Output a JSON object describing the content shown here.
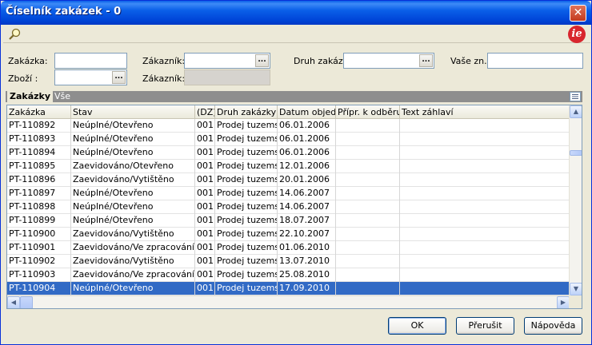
{
  "window": {
    "title": "Číselník zakázek - 0",
    "close_glyph": "✕"
  },
  "toolbar": {
    "search_icon": "search-icon",
    "logo_icon": "ie-logo-icon",
    "logo_text": "ie"
  },
  "filters": {
    "zakazka_label": "Zakázka:",
    "zakazka_value": "",
    "zakaznik_label": "Zákazník:",
    "zakaznik_value": "",
    "druh_label": "Druh zakáz.:",
    "druh_value": "",
    "vase_label": "Vaše zn.:",
    "vase_value": "",
    "zbozi_label": "Zboží  :",
    "zbozi_value": "",
    "zakaznik2_label": "Zákazník:",
    "zakaznik2_value": "",
    "dots": "..."
  },
  "section": {
    "title": "Zakázky",
    "filter": "Vše"
  },
  "grid": {
    "columns": [
      "Zakázka",
      "Stav",
      "(DZ)",
      "Druh zakázky",
      "Datum objedn.",
      "Přípr. k odběru",
      "Text záhlaví"
    ],
    "rows": [
      [
        "PT-110892",
        "Neúplné/Otevřeno",
        "001",
        "Prodej tuzemsko",
        "06.01.2006",
        "",
        ""
      ],
      [
        "PT-110893",
        "Neúplné/Otevřeno",
        "001",
        "Prodej tuzemsko",
        "06.01.2006",
        "",
        ""
      ],
      [
        "PT-110894",
        "Neúplné/Otevřeno",
        "001",
        "Prodej tuzemsko",
        "06.01.2006",
        "",
        ""
      ],
      [
        "PT-110895",
        "Zaevidováno/Otevřeno",
        "001",
        "Prodej tuzemsko",
        "12.01.2006",
        "",
        ""
      ],
      [
        "PT-110896",
        "Zaevidováno/Vytištěno",
        "001",
        "Prodej tuzemsko",
        "20.01.2006",
        "",
        ""
      ],
      [
        "PT-110897",
        "Neúplné/Otevřeno",
        "001",
        "Prodej tuzemsko",
        "14.06.2007",
        "",
        ""
      ],
      [
        "PT-110898",
        "Neúplné/Otevřeno",
        "001",
        "Prodej tuzemsko",
        "14.06.2007",
        "",
        ""
      ],
      [
        "PT-110899",
        "Neúplné/Otevřeno",
        "001",
        "Prodej tuzemsko",
        "18.07.2007",
        "",
        ""
      ],
      [
        "PT-110900",
        "Zaevidováno/Vytištěno",
        "001",
        "Prodej tuzemsko",
        "22.10.2007",
        "",
        ""
      ],
      [
        "PT-110901",
        "Zaevidováno/Ve zpracování",
        "001",
        "Prodej tuzemsko",
        "01.06.2010",
        "",
        ""
      ],
      [
        "PT-110902",
        "Zaevidováno/Vytištěno",
        "001",
        "Prodej tuzemsko",
        "13.07.2010",
        "",
        ""
      ],
      [
        "PT-110903",
        "Zaevidováno/Ve zpracování",
        "001",
        "Prodej tuzemsko",
        "25.08.2010",
        "",
        ""
      ],
      [
        "PT-110904",
        "Neúplné/Otevřeno",
        "001",
        "Prodej tuzemsko",
        "17.09.2010",
        "",
        ""
      ]
    ],
    "selected_row": 12,
    "scroll": {
      "up": "▲",
      "down": "▼",
      "left": "◀",
      "right": "▶"
    }
  },
  "buttons": {
    "ok": "OK",
    "prerusit": "Přerušit",
    "napoveda": "Nápověda"
  },
  "colors": {
    "selection": "#316ac5",
    "titlebar": "#0a5fe8",
    "accent_logo": "#d8262e"
  }
}
